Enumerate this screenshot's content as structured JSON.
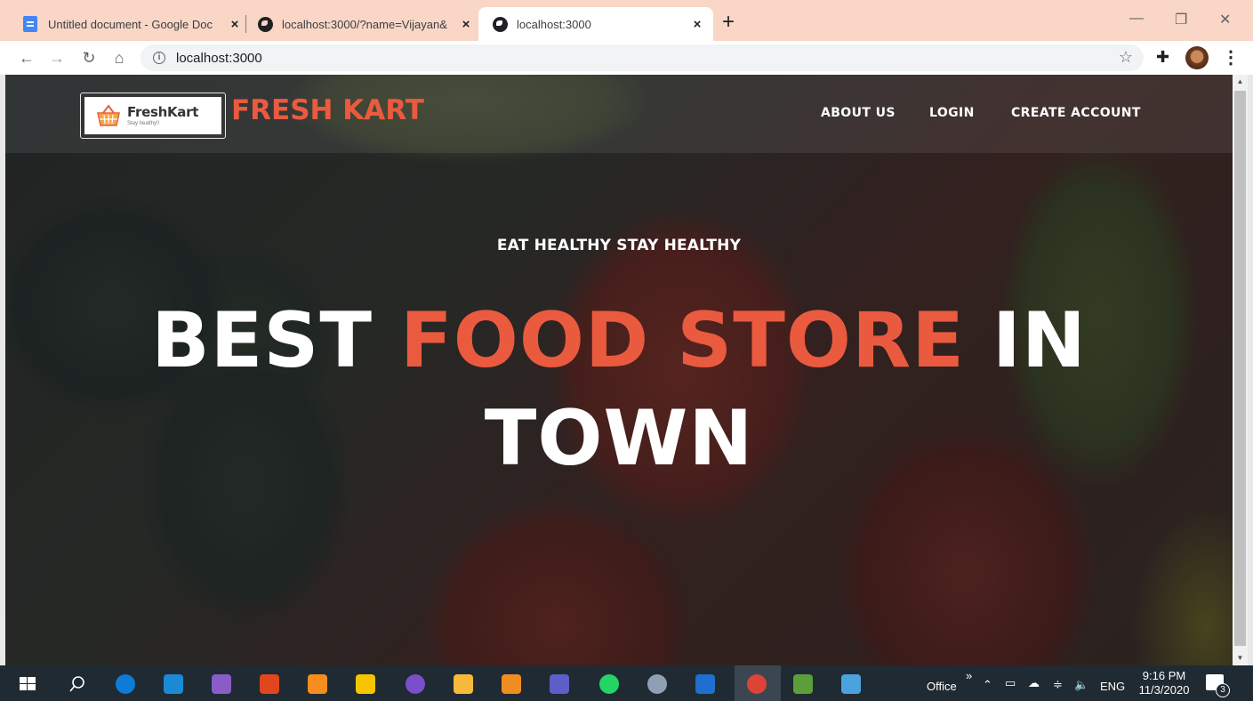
{
  "browser": {
    "tabs": [
      {
        "title": "Untitled document - Google Doc",
        "favicon": "google-docs-icon",
        "active": false
      },
      {
        "title": "localhost:3000/?name=Vijayan&",
        "favicon": "globe-icon",
        "active": false
      },
      {
        "title": "localhost:3000",
        "favicon": "globe-icon",
        "active": true
      }
    ],
    "tab_close_glyph": "×",
    "new_tab_glyph": "+",
    "address": "localhost:3000",
    "window_controls": {
      "minimize": "—",
      "maximize": "❐",
      "close": "✕"
    }
  },
  "site": {
    "logo": {
      "name": "FreshKart",
      "tagline": "Stay healthy!!"
    },
    "brand": "FRESH KART",
    "nav": [
      {
        "label": "ABOUT US"
      },
      {
        "label": "LOGIN"
      },
      {
        "label": "CREATE ACCOUNT"
      }
    ],
    "hero": {
      "tagline": "EAT HEALTHY STAY HEALTHY",
      "part1": "BEST ",
      "accent": "FOOD STORE",
      "part2": " IN TOWN"
    },
    "colors": {
      "accent": "#ea5a3f",
      "nav_text": "#ffffff"
    }
  },
  "taskbar": {
    "office_label": "Office",
    "chevron": "»",
    "language": "ENG",
    "time": "9:16 PM",
    "date": "11/3/2020",
    "notification_count": "3"
  }
}
